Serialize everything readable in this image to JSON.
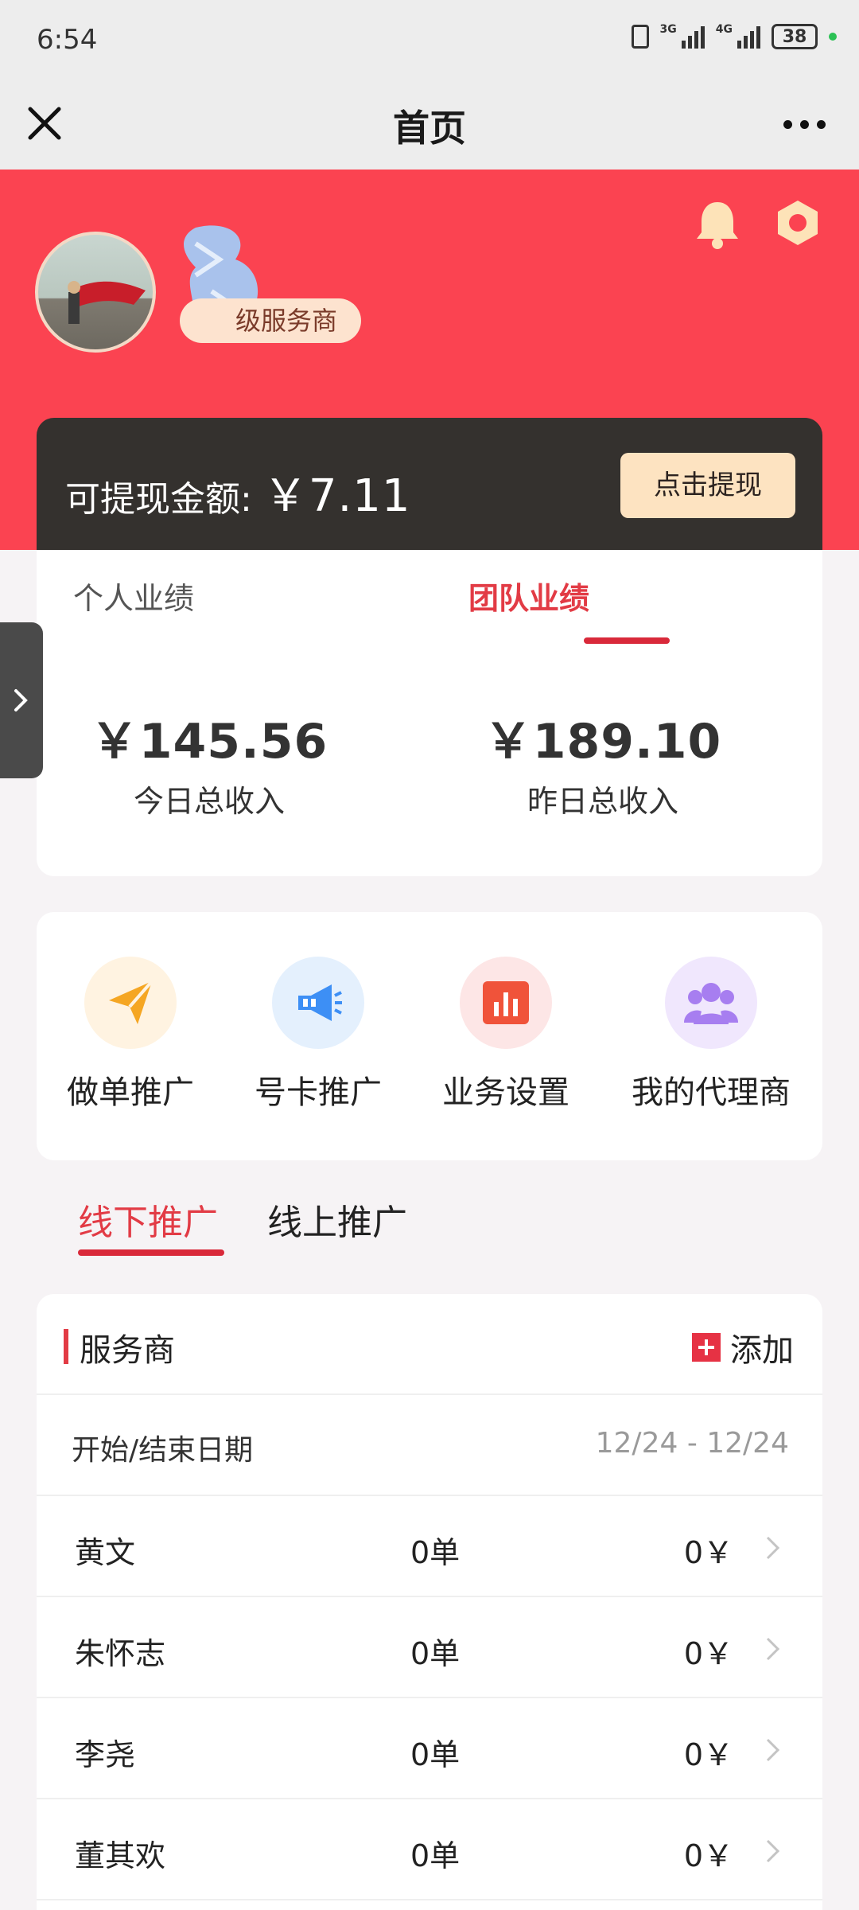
{
  "status_bar": {
    "time": "6:54",
    "network1": "3G",
    "network2": "4G",
    "battery": "38"
  },
  "title_bar": {
    "title": "首页"
  },
  "profile": {
    "level": "级服务商"
  },
  "withdraw": {
    "label": "可提现金额: ",
    "amount": "￥7.11",
    "button": "点击提现"
  },
  "stats": {
    "tabs": [
      "个人业绩",
      "团队业绩"
    ],
    "active_tab": "团队业绩",
    "items": [
      {
        "value": "￥145.56",
        "label": "今日总收入"
      },
      {
        "value": "￥189.10",
        "label": "昨日总收入"
      }
    ]
  },
  "menu": {
    "items": [
      {
        "label": "做单推广",
        "icon": "paper-plane-icon",
        "color": "#f5a623"
      },
      {
        "label": "号卡推广",
        "icon": "megaphone-icon",
        "color": "#3d8ff5"
      },
      {
        "label": "业务设置",
        "icon": "bar-chart-icon",
        "color": "#f0533a"
      },
      {
        "label": "我的代理商",
        "icon": "group-icon",
        "color": "#a77ef0"
      }
    ]
  },
  "segments": {
    "offline": "线下推广",
    "online": "线上推广",
    "active": "线下推广"
  },
  "list": {
    "title": "服务商",
    "add_label": "添加",
    "date_label": "开始/结束日期",
    "date_range": "12/24 - 12/24",
    "rows": [
      {
        "name": "黄文",
        "count": "0单",
        "amount": "0￥"
      },
      {
        "name": "朱怀志",
        "count": "0单",
        "amount": "0￥"
      },
      {
        "name": "李尧",
        "count": "0单",
        "amount": "0￥"
      },
      {
        "name": "董其欢",
        "count": "0单",
        "amount": "0￥"
      }
    ]
  },
  "colors": {
    "header_red": "#fb4351",
    "accent_red": "#e23b45",
    "dark_card": "#34312e",
    "button_cream": "#fde3c1"
  }
}
